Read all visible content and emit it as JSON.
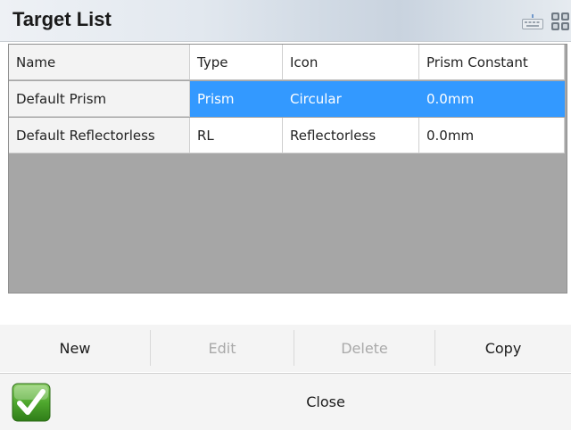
{
  "window": {
    "title": "Target List"
  },
  "icons": {
    "keyboard": "keyboard-icon",
    "grid": "grid-menu-icon",
    "confirm": "check-icon"
  },
  "colors": {
    "selection": "#3399ff",
    "empty_area": "#a6a6a6"
  },
  "table": {
    "columns": [
      "Name",
      "Type",
      "Icon",
      "Prism Constant"
    ],
    "rows": [
      {
        "name": "Default Prism",
        "type": "Prism",
        "icon": "Circular",
        "prism_constant": "0.0mm",
        "selected": true
      },
      {
        "name": "Default Reflectorless",
        "type": "RL",
        "icon": "Reflectorless",
        "prism_constant": "0.0mm",
        "selected": false
      }
    ]
  },
  "buttons": {
    "new": "New",
    "edit": "Edit",
    "delete": "Delete",
    "copy": "Copy",
    "close": "Close"
  }
}
